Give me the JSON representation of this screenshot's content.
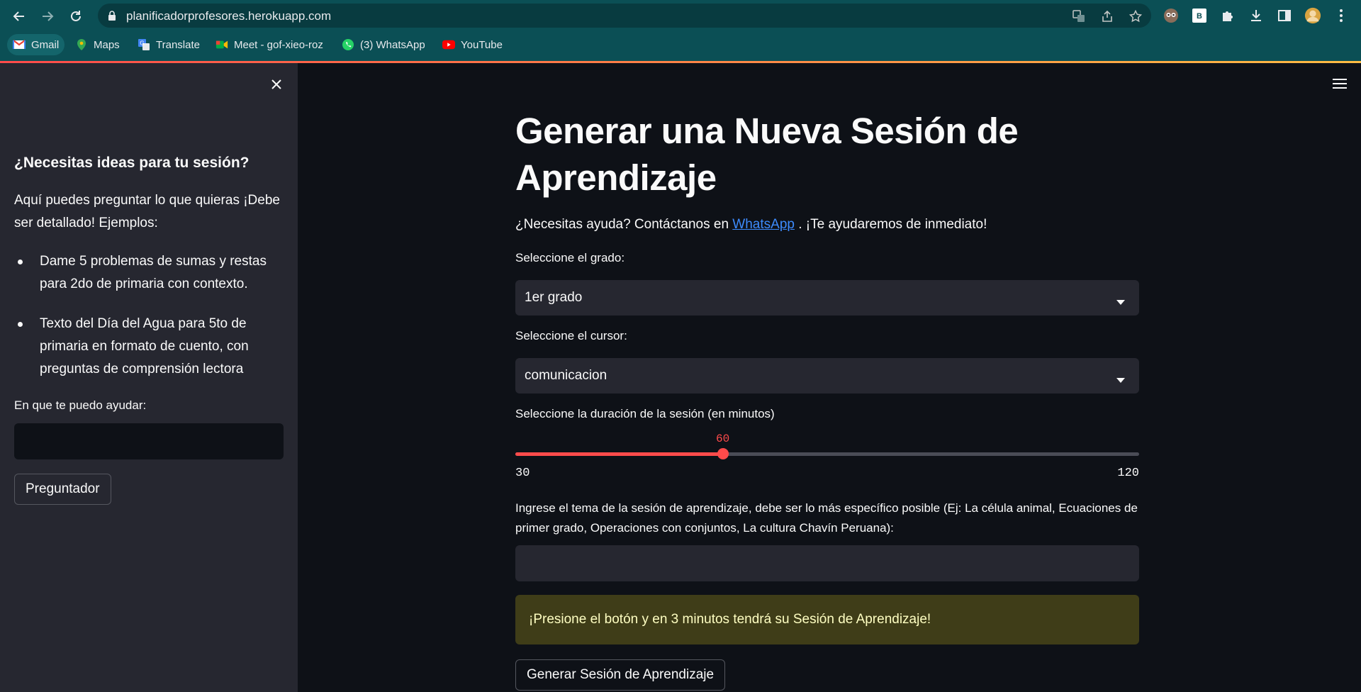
{
  "browser": {
    "url": "planificadorprofesores.herokuapp.com",
    "bookmarks": [
      {
        "label": "Gmail",
        "icon": "gmail-icon"
      },
      {
        "label": "Maps",
        "icon": "maps-icon"
      },
      {
        "label": "Translate",
        "icon": "translate-icon"
      },
      {
        "label": "Meet - gof-xieo-roz",
        "icon": "meet-icon"
      },
      {
        "label": "(3) WhatsApp",
        "icon": "whatsapp-icon"
      },
      {
        "label": "YouTube",
        "icon": "youtube-icon"
      }
    ]
  },
  "sidebar": {
    "title": "¿Necesitas ideas para tu sesión?",
    "intro": "Aquí puedes preguntar lo que quieras ¡Debe ser detallado! Ejemplos:",
    "examples": [
      "Dame 5 problemas de sumas y restas para 2do de primaria con contexto.",
      "Texto del Día del Agua para 5to de primaria en formato de cuento, con preguntas de comprensión lectora"
    ],
    "input_label": "En que te puedo ayudar:",
    "input_value": "",
    "button_label": "Preguntador"
  },
  "main": {
    "title": "Generar una Nueva Sesión de Aprendizaje",
    "help_before": "¿Necesitas ayuda? Contáctanos en ",
    "help_link": "WhatsApp",
    "help_after": " . ¡Te ayudaremos de inmediato!",
    "grade_label": "Seleccione el grado:",
    "grade_value": "1er grado",
    "course_label": "Seleccione el cursor:",
    "course_value": "comunicacion",
    "duration_label": "Seleccione la duración de la sesión (en minutos)",
    "duration_value": "60",
    "duration_min": "30",
    "duration_max": "120",
    "topic_label": "Ingrese el tema de la sesión de aprendizaje, debe ser lo más específico posible (Ej: La célula animal, Ecuaciones de primer grado, Operaciones con conjuntos, La cultura Chavín Peruana):",
    "topic_value": "",
    "warning_text": "¡Presione el botón y en 3 minutos tendrá su Sesión de Aprendizaje!",
    "generate_button": "Generar Sesión de Aprendizaje"
  },
  "colors": {
    "chrome": "#0b4f55",
    "background": "#0e1117",
    "sidebar": "#262730",
    "accent": "#ff4b4b",
    "link": "#3d8bfd"
  }
}
